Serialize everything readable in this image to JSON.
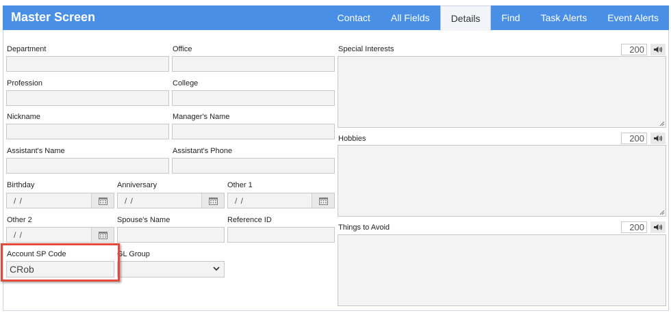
{
  "header": {
    "title": "Master Screen",
    "tabs": [
      {
        "label": "Contact"
      },
      {
        "label": "All Fields"
      },
      {
        "label": "Details",
        "active": true
      },
      {
        "label": "Find"
      },
      {
        "label": "Task Alerts"
      },
      {
        "label": "Event Alerts"
      }
    ]
  },
  "fields": {
    "department": {
      "label": "Department",
      "value": ""
    },
    "office": {
      "label": "Office",
      "value": ""
    },
    "profession": {
      "label": "Profession",
      "value": ""
    },
    "college": {
      "label": "College",
      "value": ""
    },
    "nickname": {
      "label": "Nickname",
      "value": ""
    },
    "managers_name": {
      "label": "Manager's Name",
      "value": ""
    },
    "assistants_name": {
      "label": "Assistant's Name",
      "value": ""
    },
    "assistants_phone": {
      "label": "Assistant's Phone",
      "value": ""
    },
    "birthday": {
      "label": "Birthday",
      "value": " /  /"
    },
    "anniversary": {
      "label": "Anniversary",
      "value": " /  /"
    },
    "other1": {
      "label": "Other 1",
      "value": " /  /"
    },
    "other2": {
      "label": "Other 2",
      "value": " /  /"
    },
    "spouses_name": {
      "label": "Spouse's Name",
      "value": ""
    },
    "reference_id": {
      "label": "Reference ID",
      "value": ""
    },
    "account_sp_code": {
      "label": "Account SP Code",
      "value": "CRob"
    },
    "gl_group": {
      "label": "GL Group",
      "value": ""
    }
  },
  "memos": {
    "special_interests": {
      "label": "Special Interests",
      "limit": "200"
    },
    "hobbies": {
      "label": "Hobbies",
      "limit": "200"
    },
    "things_to_avoid": {
      "label": "Things to Avoid",
      "limit": "200"
    }
  },
  "icons": {
    "calendar": "calendar-icon",
    "speaker": "speaker-icon",
    "dropdown": "chevron-down-icon"
  },
  "colors": {
    "header_bg": "#4a8fe6",
    "highlight": "#e34a3a"
  }
}
